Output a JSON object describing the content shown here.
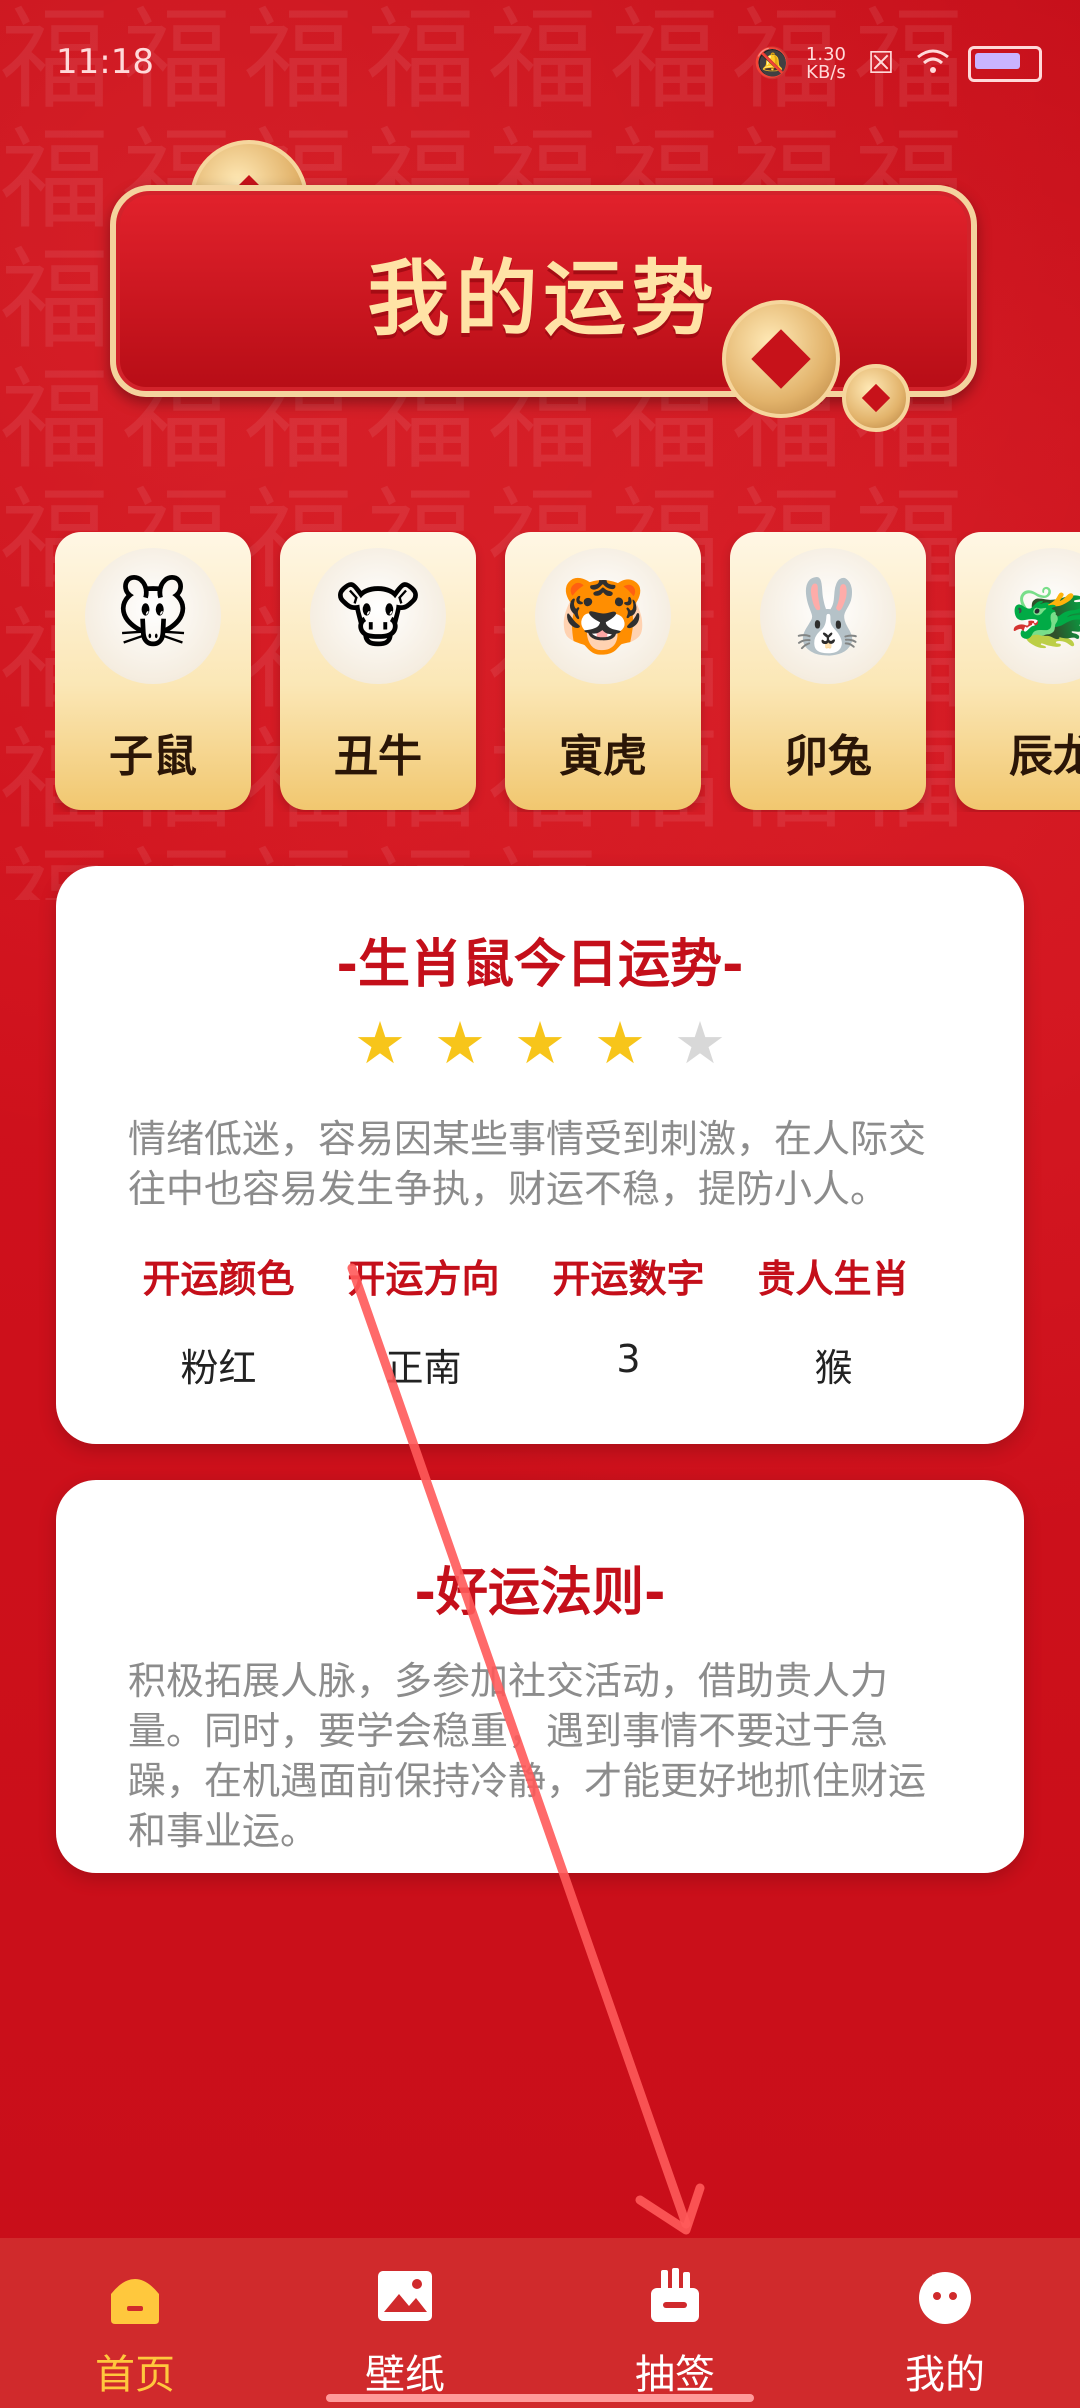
{
  "status_bar": {
    "time": "11:18",
    "net_speed": "1.30\nKB/s",
    "battery_color": "#c9b4ff"
  },
  "header": {
    "title": "我的运势"
  },
  "zodiac": [
    {
      "name": "子鼠",
      "emoji": "🐭"
    },
    {
      "name": "丑牛",
      "emoji": "🐮"
    },
    {
      "name": "寅虎",
      "emoji": "🐯"
    },
    {
      "name": "卯兔",
      "emoji": "🐰"
    },
    {
      "name": "辰龙",
      "emoji": "🐲"
    }
  ],
  "fortune": {
    "title": "-生肖鼠今日运势-",
    "rating": 4,
    "rating_max": 5,
    "description": "情绪低迷，容易因某些事情受到刺激，在人际交往中也容易发生争执，财运不稳，提防小人。",
    "lucky": [
      {
        "label": "开运颜色",
        "value": "粉红"
      },
      {
        "label": "开运方向",
        "value": "正南"
      },
      {
        "label": "开运数字",
        "value": "3"
      },
      {
        "label": "贵人生肖",
        "value": "猴"
      }
    ]
  },
  "rules": {
    "title": "-好运法则-",
    "text": "积极拓展人脉，多参加社交活动，借助贵人力量。同时，要学会稳重，遇到事情不要过于急躁，在机遇面前保持冷静，才能更好地抓住财运和事业运。"
  },
  "nav": [
    {
      "label": "首页",
      "icon": "home-icon",
      "active": true
    },
    {
      "label": "壁纸",
      "icon": "image-icon",
      "active": false
    },
    {
      "label": "抽签",
      "icon": "lottery-icon",
      "active": false
    },
    {
      "label": "我的",
      "icon": "profile-icon",
      "active": false
    }
  ],
  "colors": {
    "background": "#c9101b",
    "accent_red": "#c40f1a",
    "active_nav": "#ffc83d",
    "card_gold": "#f1c76f",
    "star_on": "#f7c51a",
    "star_off": "#d8d8d8"
  }
}
